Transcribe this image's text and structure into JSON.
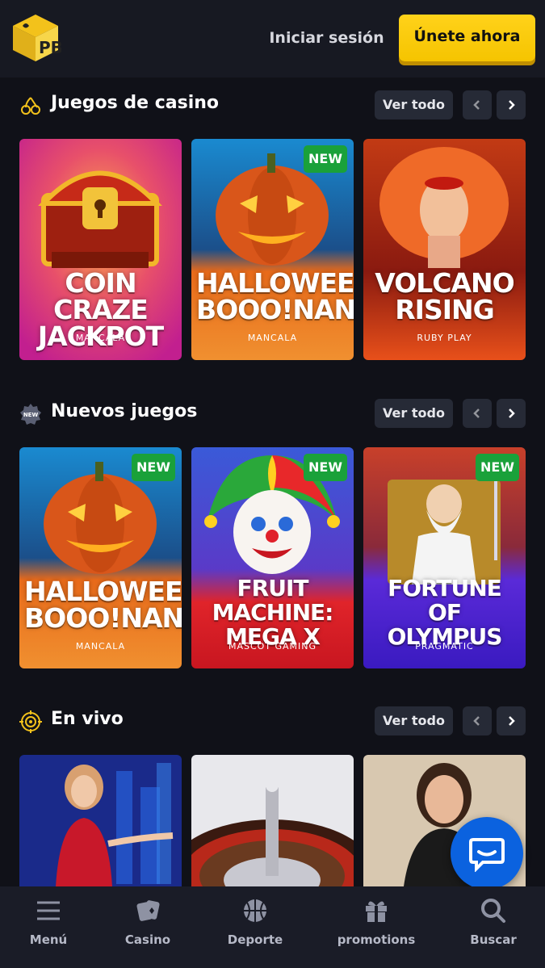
{
  "header": {
    "logo_text": "PB",
    "login_label": "Iniciar sesión",
    "join_label": "Únete ahora"
  },
  "sections": [
    {
      "title": "Juegos de casino",
      "icon": "cherries-icon",
      "view_all": "Ver todo",
      "games": [
        {
          "title": "COIN CRAZE\nJACKPOT",
          "provider": "MANCALA",
          "new": ""
        },
        {
          "title": "HALLOWEEN\nBOOO!NANZA",
          "provider": "MANCALA",
          "new": "NEW"
        },
        {
          "title": "VOLCANO\nRISING",
          "provider": "RUBY PLAY",
          "new": ""
        }
      ]
    },
    {
      "title": "Nuevos juegos",
      "icon": "new-badge-icon",
      "icon_text": "NEW",
      "view_all": "Ver todo",
      "games": [
        {
          "title": "HALLOWEEN\nBOOO!NANZA",
          "provider": "MANCALA",
          "new": "NEW"
        },
        {
          "title": "FRUIT\nMACHINE:\nMEGA X",
          "provider": "MASCOT GAMING",
          "new": "NEW"
        },
        {
          "title": "FORTUNE\nOF\nOLYMPUS",
          "provider": "PRAGMATIC",
          "new": "NEW"
        }
      ]
    },
    {
      "title": "En vivo",
      "icon": "live-target-icon",
      "view_all": "Ver todo",
      "games": [
        {
          "title": "",
          "provider": "",
          "new": ""
        },
        {
          "title": "",
          "provider": "",
          "new": ""
        },
        {
          "title": "",
          "provider": "",
          "new": ""
        }
      ]
    }
  ],
  "bottom_nav": [
    {
      "label": "Menú",
      "icon": "menu-icon"
    },
    {
      "label": "Casino",
      "icon": "cards-icon"
    },
    {
      "label": "Deporte",
      "icon": "basketball-icon"
    },
    {
      "label": "promotions",
      "icon": "gift-icon"
    },
    {
      "label": "Buscar",
      "icon": "search-icon"
    }
  ],
  "colors": {
    "background": "#101118",
    "header": "#171922",
    "accent": "#ffd21a",
    "new_badge": "#1aa13a",
    "chat": "#0b62df"
  }
}
